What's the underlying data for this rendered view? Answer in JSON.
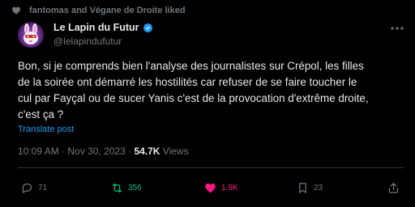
{
  "social_context": {
    "text": "fantomas and Végane de Droite liked"
  },
  "author": {
    "name": "Le Lapin du Futur",
    "handle": "@lelapindufutur",
    "verified": true
  },
  "tweet": {
    "lines": [
      "Bon, si je comprends bien l'analyse des journalistes sur Crépol, les filles",
      "de la soirée ont démarré les hostilités car refuser de se faire toucher le",
      "cul par Fayçal ou de sucer Yanis c'est de la provocation d'extrême droite,",
      "c'est ça ?"
    ],
    "translate_label": "Translate post"
  },
  "meta": {
    "time": "10:09 AM",
    "separator": " · ",
    "date": "Nov 30, 2023",
    "views_count": "54.7K",
    "views_label": " Views"
  },
  "actions": {
    "replies": "71",
    "reposts": "356",
    "likes": "1.9K",
    "bookmarks": "23"
  },
  "colors": {
    "background": "#000000",
    "text": "#e7e9ea",
    "muted": "#71767b",
    "link": "#1d9bf0",
    "repost_active": "#00ba7c",
    "like_active": "#f91880",
    "divider": "#2f3336"
  },
  "icons": {
    "social_context": "heart-icon",
    "verified": "verified-badge-icon",
    "more": "more-icon",
    "reply": "reply-icon",
    "repost": "repost-icon",
    "like": "heart-filled-icon",
    "bookmark": "bookmark-icon",
    "share": "share-icon"
  }
}
